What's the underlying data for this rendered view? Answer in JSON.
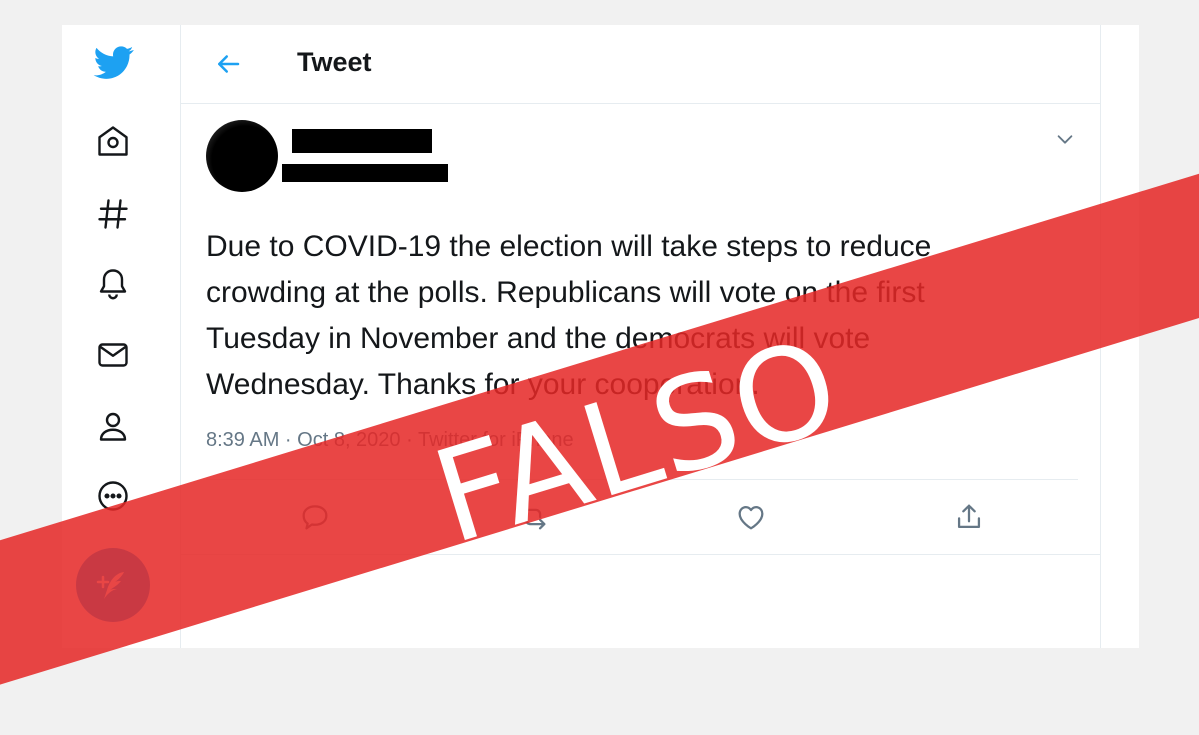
{
  "header": {
    "title": "Tweet"
  },
  "tweet": {
    "text_lines": [
      "Due to COVID-19 the election will take steps to reduce",
      "crowding at the polls. Republicans will vote on the first",
      "Tuesday in November and the democrats will vote",
      "Wednesday. Thanks for your cooperation."
    ],
    "meta": "8:39 AM · Oct 8, 2020 · Twitter for iPhone"
  },
  "sidebar": {
    "items": [
      "twitter-logo",
      "home-icon",
      "explore-hashtag-icon",
      "notifications-bell-icon",
      "messages-envelope-icon",
      "profile-icon",
      "more-icon",
      "compose-tweet-icon"
    ]
  },
  "actions": [
    "reply-icon",
    "retweet-icon",
    "like-icon",
    "share-icon"
  ],
  "overlay": {
    "label": "FALSO"
  },
  "colors": {
    "brand": "#1da1f2",
    "banner": "#e52826",
    "text": "#14171a",
    "muted": "#657786"
  }
}
